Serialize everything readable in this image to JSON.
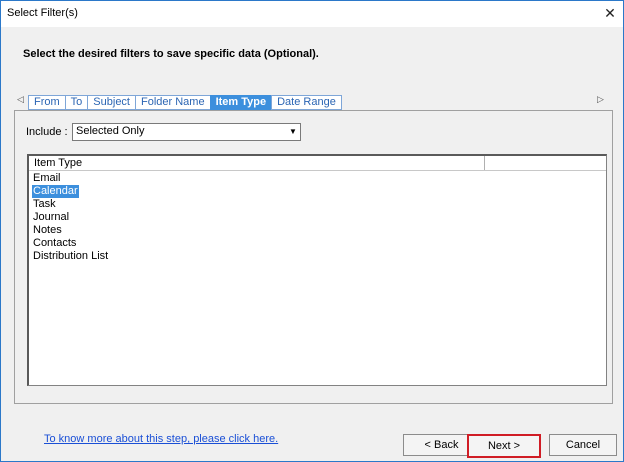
{
  "window": {
    "title": "Select Filter(s)"
  },
  "instruction": "Select the desired filters to save specific data (Optional).",
  "tabs": [
    {
      "label": "From",
      "active": false
    },
    {
      "label": "To",
      "active": false
    },
    {
      "label": "Subject",
      "active": false
    },
    {
      "label": "Folder Name",
      "active": false
    },
    {
      "label": "Item Type",
      "active": true
    },
    {
      "label": "Date Range",
      "active": false
    }
  ],
  "include": {
    "label": "Include :",
    "value": "Selected Only"
  },
  "list": {
    "column_header": "Item Type",
    "items": [
      "Email",
      "Calendar",
      "Task",
      "Journal",
      "Notes",
      "Contacts",
      "Distribution List"
    ],
    "selected": "Calendar"
  },
  "help_link": "To know more about this step, please click here.",
  "buttons": {
    "back": "< Back",
    "next": "Next >",
    "cancel": "Cancel"
  },
  "colors": {
    "accent": "#3c8fdd",
    "next_highlight": "#d01c25",
    "link": "#1a4fd6"
  },
  "icons": {
    "close": "close-icon",
    "tab_left": "chevron-left-icon",
    "tab_right": "chevron-right-icon",
    "dropdown": "chevron-down-icon"
  }
}
